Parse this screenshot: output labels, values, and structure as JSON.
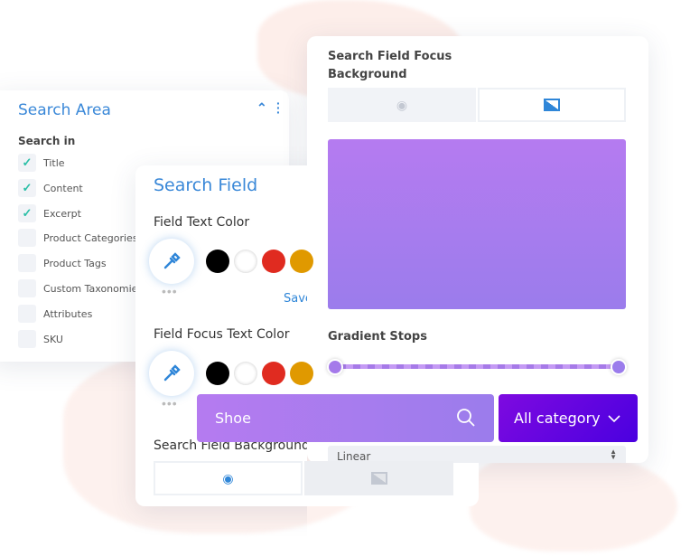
{
  "search_area": {
    "title": "Search Area",
    "search_in_label": "Search in",
    "items": [
      {
        "label": "Title",
        "checked": true
      },
      {
        "label": "Content",
        "checked": true
      },
      {
        "label": "Excerpt",
        "checked": true
      },
      {
        "label": "Product Categories",
        "checked": false
      },
      {
        "label": "Product Tags",
        "checked": false
      },
      {
        "label": "Custom Taxonomies",
        "checked": false
      },
      {
        "label": "Attributes",
        "checked": false
      },
      {
        "label": "SKU",
        "checked": false
      }
    ]
  },
  "search_field": {
    "title": "Search Field",
    "text_color_label": "Field Text Color",
    "save_label": "Save",
    "focus_text_color_label": "Field Focus Text Color",
    "background_label": "Search Field Background",
    "swatches": [
      "#000000",
      "#ffffff",
      "#e02b20",
      "#e09900"
    ]
  },
  "focus_bg": {
    "title": "Search Field Focus Background",
    "gradient_top": "#b57bf0",
    "gradient_bottom": "#9b7cec",
    "gradient_stops_label": "Gradient Stops",
    "type_value": "Linear"
  },
  "search_bar": {
    "value": "Shoe",
    "category_label": "All category"
  },
  "colors": {
    "accent": "#3a88d8",
    "check": "#2bbfa7",
    "category_start": "#7e0ae0",
    "category_end": "#4a00e0"
  }
}
